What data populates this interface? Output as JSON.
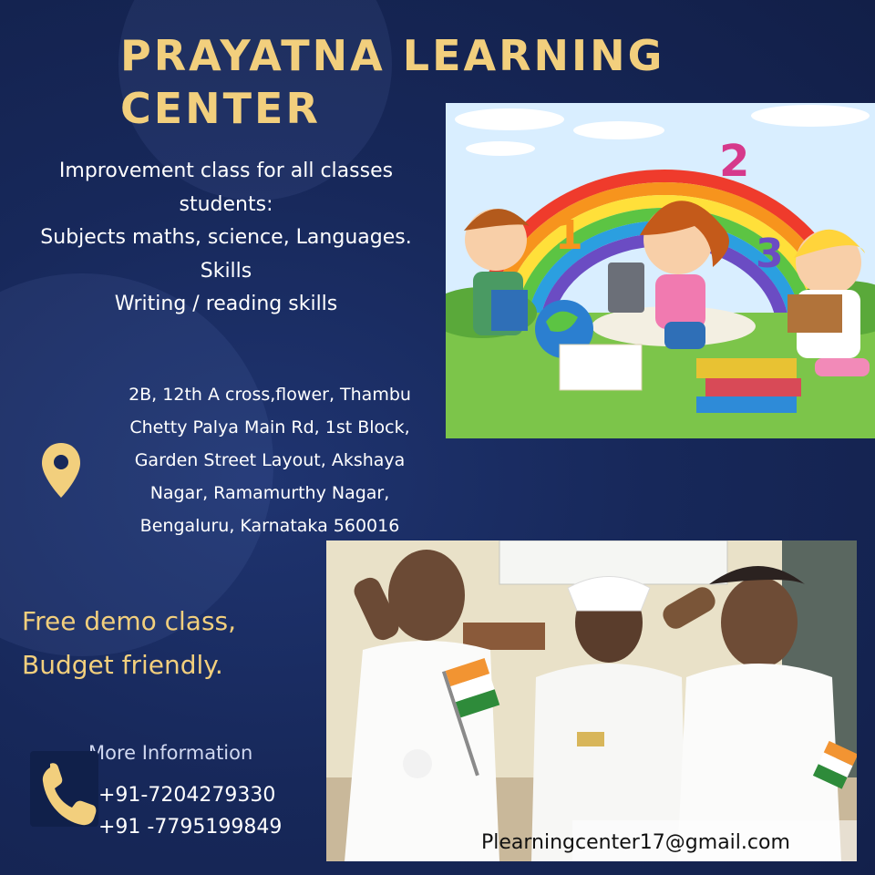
{
  "header": {
    "title_line1": "PRAYATNA LEARNING",
    "title_line2": "CENTER"
  },
  "intro": {
    "lines": [
      "Improvement class for all classes",
      "students:",
      "Subjects maths, science, Languages.",
      "Skills",
      "Writing / reading skills"
    ]
  },
  "address": {
    "icon": "map-pin-icon",
    "lines": [
      "2B, 12th A cross,flower, Thambu",
      "Chetty Palya Main Rd, 1st Block,",
      "Garden Street Layout, Akshaya",
      "Nagar, Ramamurthy Nagar,",
      "Bengaluru, Karnataka 560016"
    ]
  },
  "offer": {
    "line1": "Free demo class,",
    "line2": "Budget friendly."
  },
  "contact": {
    "heading": "More Information",
    "icon": "phone-icon",
    "phone1": "+91-7204279330",
    "phone2": "+91 -7795199849",
    "email": "Plearningcenter17@gmail.com"
  },
  "colors": {
    "background": "#17285a",
    "accent_gold": "#f2cf7d",
    "text": "#ffffff"
  }
}
